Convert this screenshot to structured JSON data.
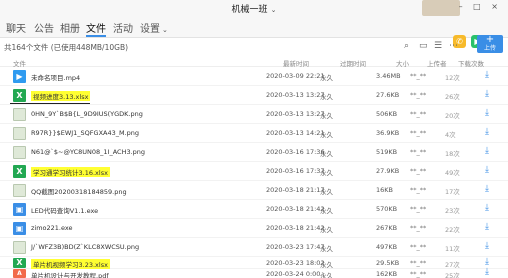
{
  "window": {
    "title": "机械一班",
    "title_chevron": "⌄",
    "controls": "– □ ×"
  },
  "tabs": [
    {
      "label": "聊天"
    },
    {
      "label": "公告"
    },
    {
      "label": "相册"
    },
    {
      "label": "文件"
    },
    {
      "label": "活动"
    },
    {
      "label": "设置",
      "dropdown": "⌄"
    }
  ],
  "header_buttons": {
    "call": "✆",
    "video": "▶",
    "more": "+"
  },
  "file_bar": {
    "count_text": "共164个文件 (已使用448MB/10GB)",
    "icons": [
      "⌕",
      "▭",
      "☰",
      "⋯"
    ],
    "upload_label": "上传",
    "upload_plus": "+"
  },
  "columns": {
    "name": "文件",
    "date": "最新时间",
    "expire": "过期时间",
    "size": "大小",
    "uploader": "上传者",
    "downloads": "下载次数"
  },
  "files": [
    {
      "icon": "▶",
      "name": "未命名项目.mp4",
      "date": "2020-03-09 22:21",
      "expire": "永久",
      "size": "3.46MB",
      "uploader": "**_**",
      "downloads": "12次",
      "highlight": false
    },
    {
      "icon": "X",
      "name": "视频进度3.13.xlsx",
      "date": "2020-03-13 13:27",
      "expire": "永久",
      "size": "27.6KB",
      "uploader": "**_**",
      "downloads": "26次",
      "highlight": true
    },
    {
      "icon": "",
      "name": "0HN_9Y`B$B{L_9D9IUS(YGDK.png",
      "date": "2020-03-13 13:27",
      "expire": "永久",
      "size": "506KB",
      "uploader": "**_**",
      "downloads": "20次",
      "highlight": false
    },
    {
      "icon": "",
      "name": "R97R}}$EWJ1_SQFGXA43_M.png",
      "date": "2020-03-13 14:21",
      "expire": "永久",
      "size": "36.9KB",
      "uploader": "**_**",
      "downloads": "4次",
      "highlight": false
    },
    {
      "icon": "",
      "name": "N61@`$~@YC8UN08_1I_ACH3.png",
      "date": "2020-03-16 17:36",
      "expire": "永久",
      "size": "519KB",
      "uploader": "**_**",
      "downloads": "18次",
      "highlight": false
    },
    {
      "icon": "X",
      "name": "学习通学习统计3.16.xlsx",
      "date": "2020-03-16 17:37",
      "expire": "永久",
      "size": "27.9KB",
      "uploader": "**_**",
      "downloads": "49次",
      "highlight": true
    },
    {
      "icon": "",
      "name": "QQ截图20200318184859.png",
      "date": "2020-03-18 21:17",
      "expire": "永久",
      "size": "16KB",
      "uploader": "**_**",
      "downloads": "17次",
      "highlight": false
    },
    {
      "icon": "▣",
      "name": "LED代码查询V1.1.exe",
      "date": "2020-03-18 21:42",
      "expire": "永久",
      "size": "570KB",
      "uploader": "**_**",
      "downloads": "23次",
      "highlight": false
    },
    {
      "icon": "▣",
      "name": "zimo221.exe",
      "date": "2020-03-18 21:42",
      "expire": "永久",
      "size": "267KB",
      "uploader": "**_**",
      "downloads": "22次",
      "highlight": false
    },
    {
      "icon": "",
      "name": "J/`WFZ3B)BD(Z`KLC8XWCSU.png",
      "date": "2020-03-23 17:47",
      "expire": "永久",
      "size": "497KB",
      "uploader": "**_**",
      "downloads": "11次",
      "highlight": false
    },
    {
      "icon": "X",
      "name": "单片机视频学习3.23.xlsx",
      "date": "2020-03-23 18:02",
      "expire": "永久",
      "size": "29.5KB",
      "uploader": "**_**",
      "downloads": "27次",
      "highlight": true
    },
    {
      "icon": "A",
      "name": "单片机设计与开发教程.pdf",
      "date": "2020-03-24 0:00",
      "expire": "永久",
      "size": "162KB",
      "uploader": "**_**",
      "downloads": "25次",
      "highlight": false
    }
  ],
  "download_icon": "⤓"
}
